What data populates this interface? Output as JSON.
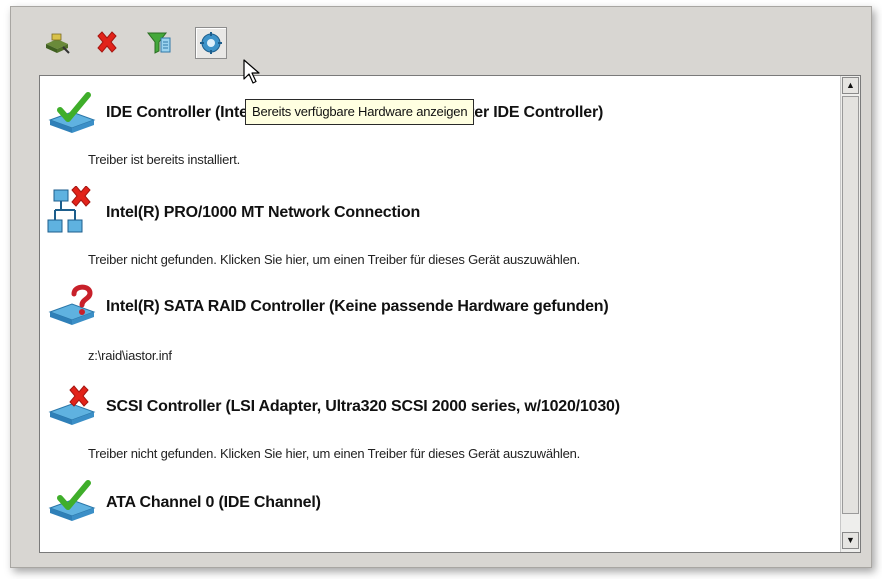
{
  "toolbar": {
    "buttons": [
      {
        "icon": "add-driver-icon"
      },
      {
        "icon": "delete-icon"
      },
      {
        "icon": "filter-icon"
      },
      {
        "icon": "show-hardware-icon",
        "active": true
      }
    ]
  },
  "tooltip": {
    "text": "Bereits verfügbare Hardware anzeigen"
  },
  "devices": [
    {
      "title": "IDE Controller (Intel(R) 82371AB/EB PCI Bus Master IDE Controller)",
      "description": "Treiber ist bereits installiert.",
      "status": "installed"
    },
    {
      "title": "Intel(R) PRO/1000 MT Network Connection",
      "description": "Treiber nicht gefunden. Klicken Sie hier, um einen Treiber für dieses Gerät auszuwählen.",
      "status": "not-found"
    },
    {
      "title": "Intel(R) SATA RAID Controller (Keine passende Hardware gefunden)",
      "description": "z:\\raid\\iastor.inf",
      "status": "unknown"
    },
    {
      "title": "SCSI Controller (LSI Adapter, Ultra320 SCSI 2000 series, w/1020/1030)",
      "description": "Treiber nicht gefunden. Klicken Sie hier, um einen Treiber für dieses Gerät auszuwählen.",
      "status": "not-found"
    },
    {
      "title": "ATA Channel 0 (IDE Channel)",
      "description": "",
      "status": "installed"
    }
  ],
  "colors": {
    "installed": "#3fae2a",
    "error": "#e2231a",
    "unknown": "#c8202a",
    "device": "#3d93c9"
  }
}
